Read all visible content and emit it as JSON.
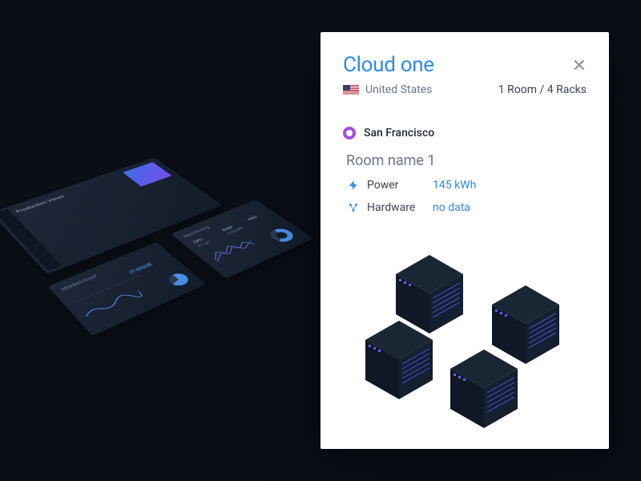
{
  "card": {
    "title": "Cloud one",
    "country": "United States",
    "rooms_meta": "1 Room / 4 Racks",
    "location": {
      "city": "San Francisco",
      "room_name": "Room name 1",
      "stats": {
        "power": {
          "label": "Power",
          "value": "145 kWh"
        },
        "hardware": {
          "label": "Hardware",
          "value": "no data"
        }
      }
    }
  },
  "bg_panels": {
    "panel1_title": "Production Views",
    "panel2_title": "Marketcloud",
    "panel2_issue": "IT-ISSUE",
    "panel3_title": "Monitoring",
    "cpu_label": "CPU",
    "cpu_value": "2.1 gH",
    "ram_label": "RAM",
    "ram_value": "1024 MB",
    "hdd_label": "HDD",
    "hdd_value": "Usage"
  }
}
